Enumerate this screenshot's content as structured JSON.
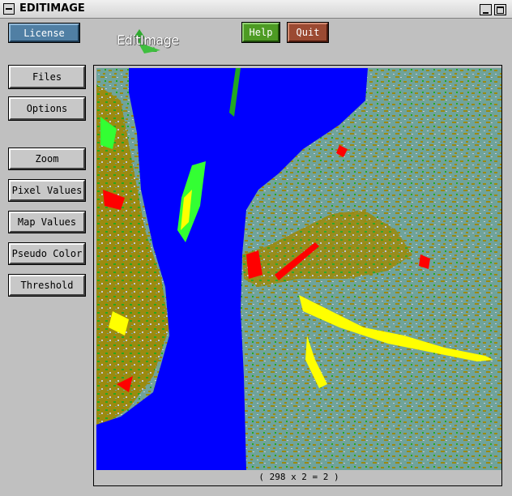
{
  "window": {
    "title": "EDITIMAGE"
  },
  "header": {
    "license_label": "License",
    "logo_text": "EditImage",
    "help_label": "Help",
    "quit_label": "Quit"
  },
  "sidebar": {
    "items": [
      {
        "label": "Files"
      },
      {
        "label": "Options"
      },
      {
        "label": "Zoom"
      },
      {
        "label": "Pixel Values"
      },
      {
        "label": "Map Values"
      },
      {
        "label": "Pseudo Color"
      },
      {
        "label": "Threshold"
      }
    ]
  },
  "image": {
    "description_colors": {
      "water": "#0000ff",
      "land_teal": "#6fa39b",
      "olive": "#9b8a10",
      "green": "#22a822",
      "bright_green": "#33ff33",
      "yellow": "#ffff00",
      "red": "#ff0000",
      "light_gray": "#c8c8d8"
    }
  },
  "status": {
    "text": "( 298 x    2 =    2 )"
  },
  "colors": {
    "background": "#c0c0c0",
    "license_button": "#507fa4",
    "help_button": "#4d9b23",
    "quit_button": "#9b4a32"
  }
}
